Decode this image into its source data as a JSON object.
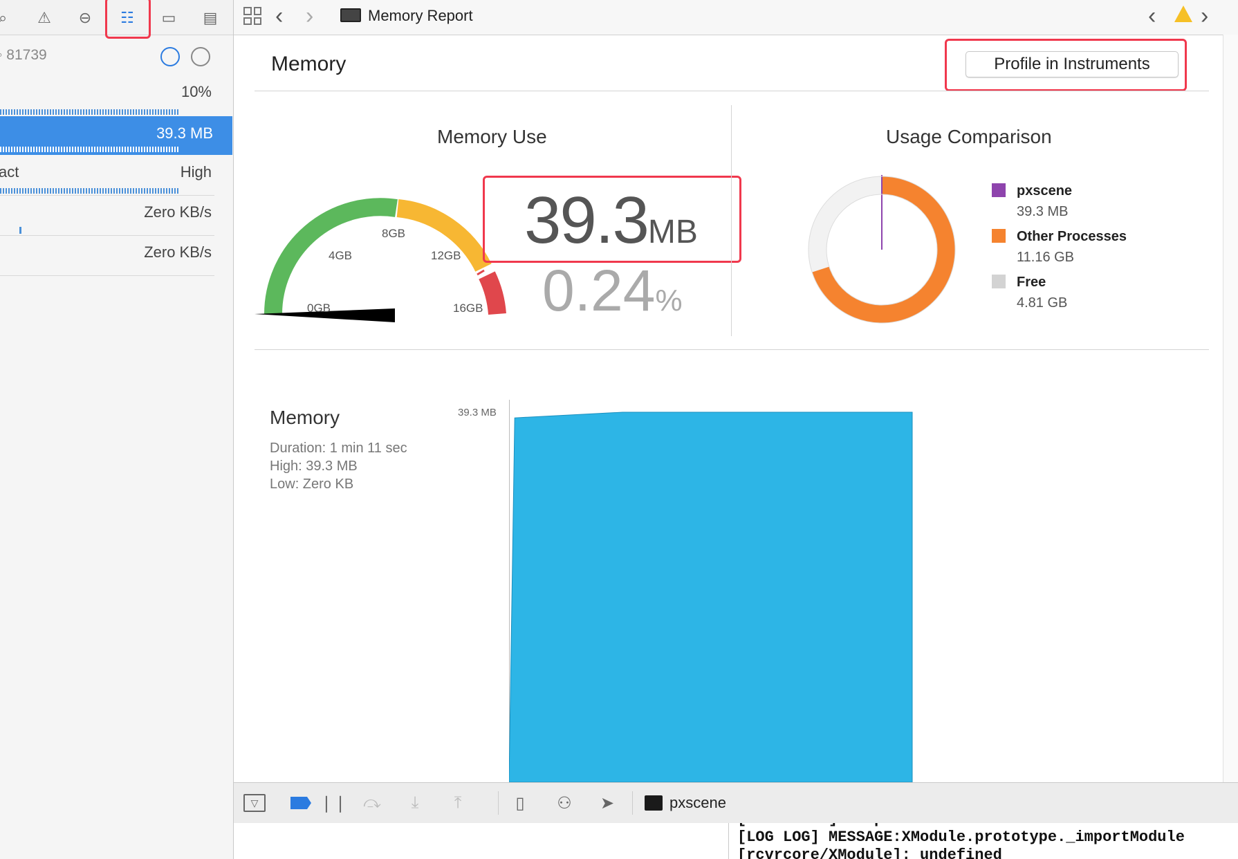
{
  "sidebar": {
    "pid": "81739",
    "rows": [
      {
        "label": "",
        "value": "10%"
      },
      {
        "label": "",
        "value": "39.3 MB",
        "selected": true
      },
      {
        "label": "act",
        "value": "High"
      },
      {
        "label": "",
        "value": "Zero KB/s"
      },
      {
        "label": "",
        "value": "Zero KB/s"
      }
    ]
  },
  "topbar": {
    "title": "Memory Report",
    "grid_icon": "grid-icon",
    "back_icon": "chevron-left-icon",
    "forward_icon": "chevron-right-icon",
    "warning_icon": "warning-icon",
    "prev_issue": "‹",
    "next_issue": "›"
  },
  "header": {
    "title": "Memory",
    "profile_button": "Profile in Instruments"
  },
  "memory_use": {
    "title": "Memory Use",
    "value": "39.3",
    "unit": "MB",
    "percent": "0.24",
    "percent_sign": "%",
    "gauge_labels": [
      "0GB",
      "4GB",
      "8GB",
      "12GB",
      "16GB"
    ],
    "gauge_colors": {
      "green": "#5cb85c",
      "yellow": "#f7b733",
      "red": "#e0474c"
    }
  },
  "usage_comparison": {
    "title": "Usage Comparison",
    "legend": [
      {
        "name": "pxscene",
        "value": "39.3 MB",
        "color": "#8e44ad"
      },
      {
        "name": "Other Processes",
        "value": "11.16 GB",
        "color": "#f5832f"
      },
      {
        "name": "Free",
        "value": "4.81 GB",
        "color": "#d3d3d3"
      }
    ]
  },
  "chart_section": {
    "title": "Memory",
    "duration": "Duration: 1 min 11 sec",
    "high": "High: 39.3 MB",
    "low": "Low: Zero KB",
    "y_max_label": "39.3 MB"
  },
  "chart_data": {
    "type": "area",
    "title": "Memory",
    "ylabel": "",
    "xlabel": "",
    "ylim": [
      0,
      39.3
    ],
    "ytick_labels": [
      "39.3 MB"
    ],
    "color": "#2db5e6",
    "x": [
      0,
      1,
      20,
      71
    ],
    "values": [
      0,
      38.7,
      39.3,
      39.3
    ]
  },
  "debugbar": {
    "process": "pxscene"
  },
  "console": {
    "lines": [
      "[LOG ERROR] Http Status Code:",
      "[LOG LOG] MESSAGE:XModule.prototype._importModule",
      "[rcvrcore/XModule]: undefined"
    ]
  }
}
